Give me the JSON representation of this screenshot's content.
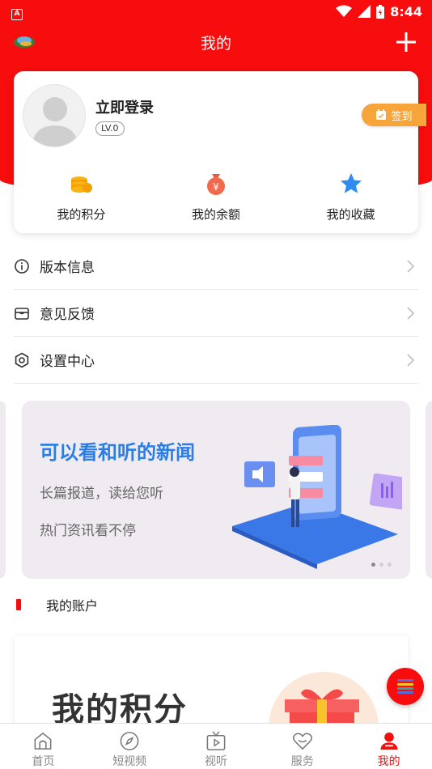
{
  "colors": {
    "brand_red": "#f70d0d",
    "signin_orange": "#f7a53a",
    "banner_blue": "#2a7de6"
  },
  "status_bar": {
    "time": "8:44",
    "app_badge": "A"
  },
  "header": {
    "title": "我的"
  },
  "user": {
    "login_label": "立即登录",
    "level": "LV.0",
    "signin_label": "签到",
    "stats": [
      {
        "label": "我的积分",
        "icon": "coins-icon"
      },
      {
        "label": "我的余额",
        "icon": "money-bag-icon"
      },
      {
        "label": "我的收藏",
        "icon": "star-icon"
      }
    ]
  },
  "menu": [
    {
      "label": "版本信息",
      "icon": "info-icon"
    },
    {
      "label": "意见反馈",
      "icon": "feedback-icon"
    },
    {
      "label": "设置中心",
      "icon": "settings-icon"
    }
  ],
  "banner": {
    "title": "可以看和听的新闻",
    "line1": "长篇报道，读给您听",
    "line2": "热门资讯看不停",
    "active_slide": 1,
    "slide_count": 3
  },
  "account": {
    "section_label": "我的账户",
    "points_title": "我的积分"
  },
  "bottom_nav": [
    {
      "label": "首页",
      "icon": "home-icon",
      "active": false
    },
    {
      "label": "短视频",
      "icon": "compass-icon",
      "active": false
    },
    {
      "label": "视听",
      "icon": "tv-icon",
      "active": false
    },
    {
      "label": "服务",
      "icon": "heart-icon",
      "active": false
    },
    {
      "label": "我的",
      "icon": "person-icon",
      "active": true
    }
  ]
}
